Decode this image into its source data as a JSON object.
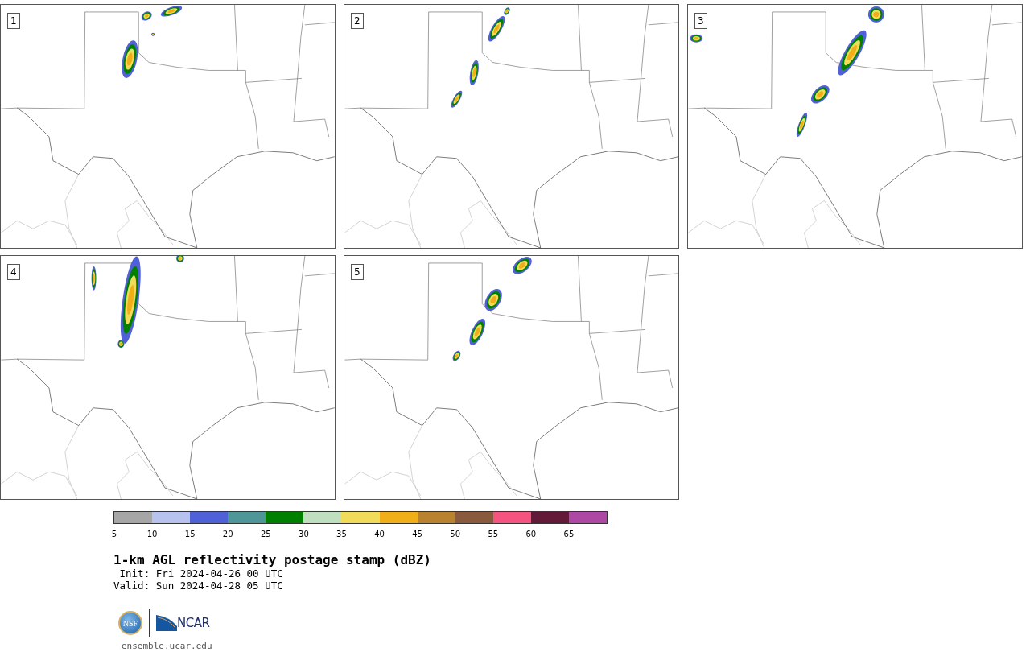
{
  "panels": [
    {
      "label": "1"
    },
    {
      "label": "2"
    },
    {
      "label": "3"
    },
    {
      "label": "4"
    },
    {
      "label": "5"
    }
  ],
  "colorbar": {
    "bins": [
      {
        "color": "#a6a6a6",
        "tick": "5"
      },
      {
        "color": "#b7c2ee",
        "tick": "10"
      },
      {
        "color": "#5060d6",
        "tick": "15"
      },
      {
        "color": "#4f9699",
        "tick": "20"
      },
      {
        "color": "#008000",
        "tick": "25"
      },
      {
        "color": "#bfdfbf",
        "tick": "30"
      },
      {
        "color": "#f0db5a",
        "tick": "35"
      },
      {
        "color": "#f0ae18",
        "tick": "40"
      },
      {
        "color": "#b8822f",
        "tick": "45"
      },
      {
        "color": "#8a5a3e",
        "tick": "50"
      },
      {
        "color": "#f55480",
        "tick": "55"
      },
      {
        "color": "#631a38",
        "tick": "60"
      },
      {
        "color": "#ad48a4",
        "tick": "65"
      }
    ]
  },
  "title": "1-km AGL reflectivity postage stamp (dBZ)",
  "init": " Init: Fri 2024-04-26 00 UTC",
  "valid": "Valid: Sun 2024-04-28 05 UTC",
  "logos": {
    "nsf": "NSF",
    "ncar": "NCAR"
  },
  "footer": "ensemble.ucar.edu"
}
